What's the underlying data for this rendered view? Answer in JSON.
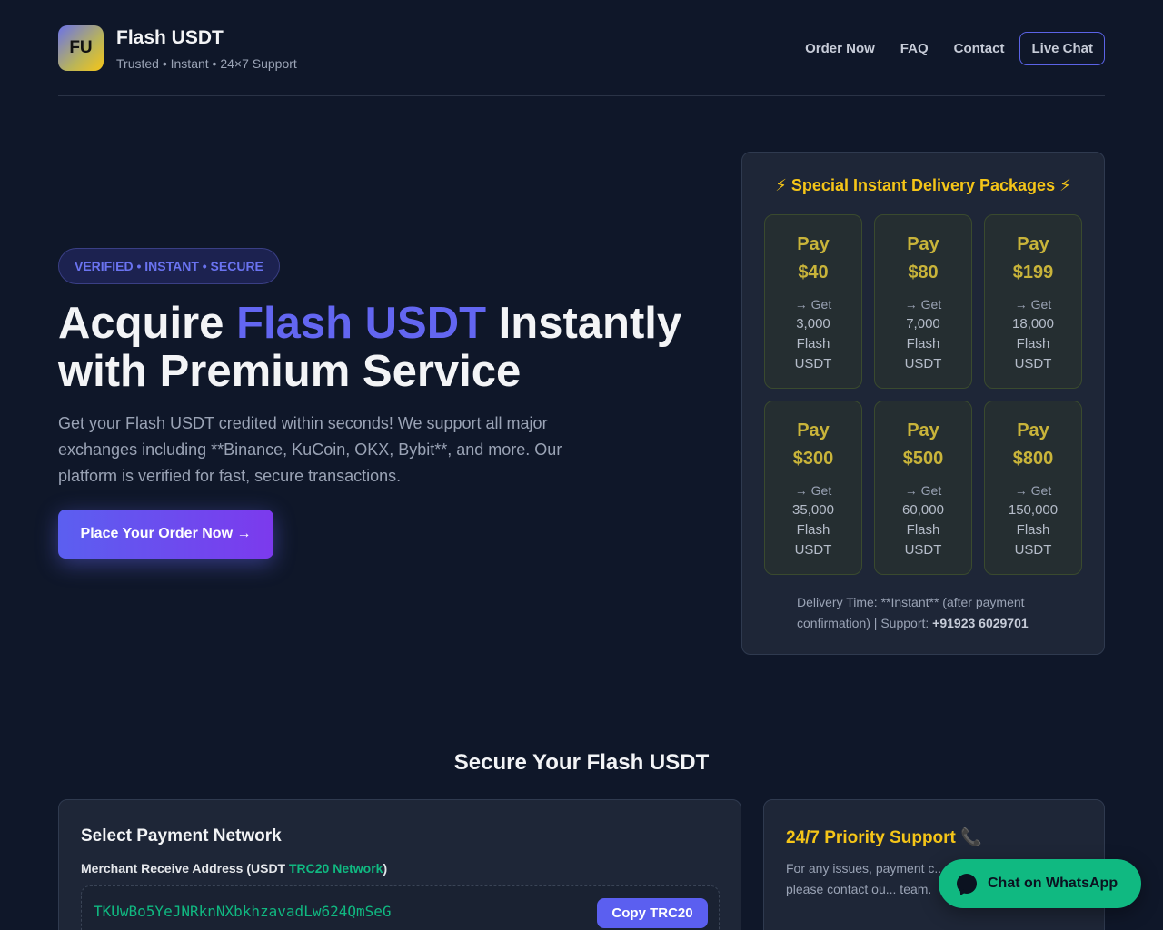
{
  "header": {
    "logo": "FU",
    "title": "Flash USDT",
    "subtitle": "Trusted • Instant • 24×7 Support",
    "nav": [
      "Order Now",
      "FAQ",
      "Contact"
    ],
    "live_chat": "Live Chat"
  },
  "hero": {
    "badge": "VERIFIED • INSTANT • SECURE",
    "title_pre": "Acquire ",
    "title_highlight": "Flash USDT",
    "title_post": " Instantly with Premium Service",
    "description": "Get your Flash USDT credited within seconds! We support all major exchanges including **Binance, KuCoin, OKX, Bybit**, and more. Our platform is verified for fast, secure transactions.",
    "cta": "Place Your Order Now →"
  },
  "packages": {
    "title": "⚡ Special Instant Delivery Packages ⚡",
    "items": [
      {
        "pay": "Pay",
        "price": "$40",
        "get": "→ Get",
        "amount": "3,000",
        "unit1": "Flash",
        "unit2": "USDT"
      },
      {
        "pay": "Pay",
        "price": "$80",
        "get": "→ Get",
        "amount": "7,000",
        "unit1": "Flash",
        "unit2": "USDT"
      },
      {
        "pay": "Pay",
        "price": "$199",
        "get": "→ Get",
        "amount": "18,000",
        "unit1": "Flash",
        "unit2": "USDT"
      },
      {
        "pay": "Pay",
        "price": "$300",
        "get": "→ Get",
        "amount": "35,000",
        "unit1": "Flash",
        "unit2": "USDT"
      },
      {
        "pay": "Pay",
        "price": "$500",
        "get": "→ Get",
        "amount": "60,000",
        "unit1": "Flash",
        "unit2": "USDT"
      },
      {
        "pay": "Pay",
        "price": "$800",
        "get": "→ Get",
        "amount": "150,000",
        "unit1": "Flash",
        "unit2": "USDT"
      }
    ],
    "footer_text": "Delivery Time: **Instant** (after payment confirmation) | Support: ",
    "footer_phone": "+91923 6029701"
  },
  "section": {
    "title": "Secure Your Flash USDT"
  },
  "payment": {
    "title": "Select Payment Network",
    "merchant_pre": "Merchant Receive Address (USDT ",
    "merchant_network": "TRC20 Network",
    "merchant_post": ")",
    "address": "TKUwBo5YeJNRknNXbkhzavadLw624QmSeG",
    "copy_label": "Copy TRC20"
  },
  "support": {
    "title": "24/7 Priority Support",
    "phone_icon": "📞",
    "text": "For any issues, payment c... orders, please contact ou... team."
  },
  "whatsapp": {
    "label": "Chat on WhatsApp"
  },
  "colors": {
    "background": "#0f1729",
    "accent": "#6366f1",
    "gold": "#f5c518",
    "green": "#10b981"
  }
}
